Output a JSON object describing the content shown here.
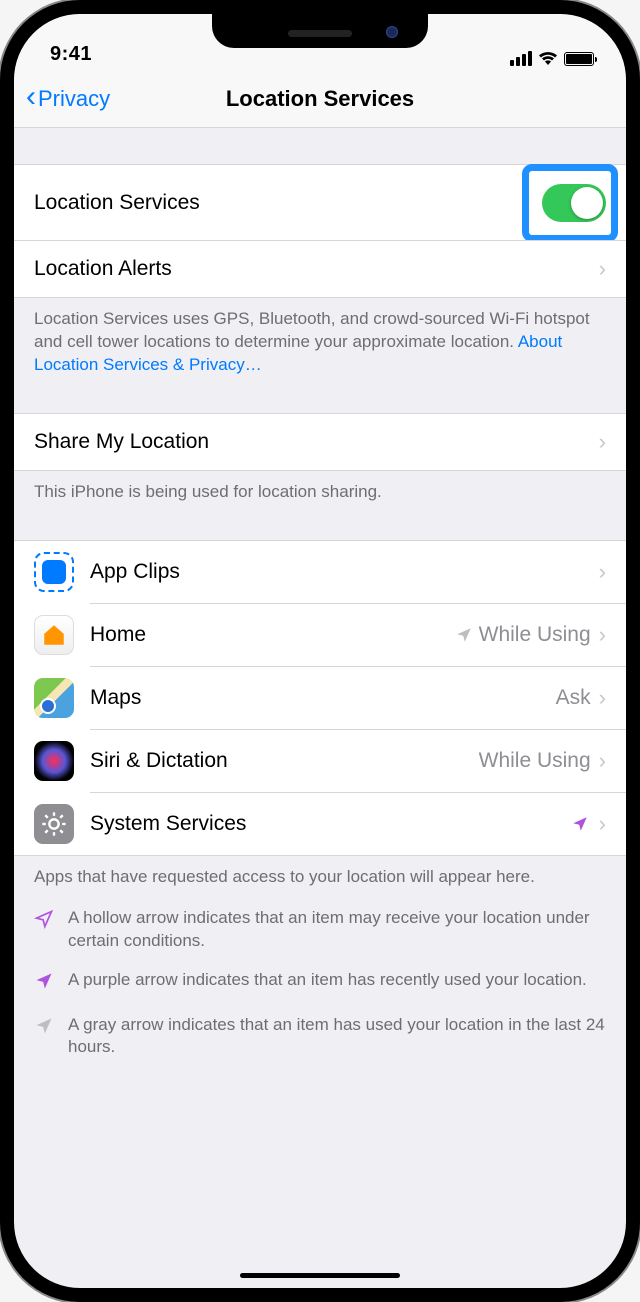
{
  "status": {
    "time": "9:41"
  },
  "nav": {
    "back": "Privacy",
    "title": "Location Services"
  },
  "section1": {
    "locationServices": "Location Services",
    "locationAlerts": "Location Alerts",
    "footer": "Location Services uses GPS, Bluetooth, and crowd-sourced Wi-Fi hotspot and cell tower locations to determine your approximate location. ",
    "footerLink": "About Location Services & Privacy…"
  },
  "section2": {
    "shareMyLocation": "Share My Location",
    "footer": "This iPhone is being used for location sharing."
  },
  "apps": [
    {
      "name": "App Clips",
      "status": ""
    },
    {
      "name": "Home",
      "status": "While Using",
      "arrow": "gray"
    },
    {
      "name": "Maps",
      "status": "Ask"
    },
    {
      "name": "Siri & Dictation",
      "status": "While Using"
    },
    {
      "name": "System Services",
      "status": "",
      "arrow": "purple"
    }
  ],
  "appsFooter": "Apps that have requested access to your location will appear here.",
  "legend": [
    {
      "type": "hollow",
      "text": "A hollow arrow indicates that an item may receive your location under certain conditions."
    },
    {
      "type": "purple",
      "text": "A purple arrow indicates that an item has recently used your location."
    },
    {
      "type": "gray",
      "text": "A gray arrow indicates that an item has used your location in the last 24 hours."
    }
  ]
}
